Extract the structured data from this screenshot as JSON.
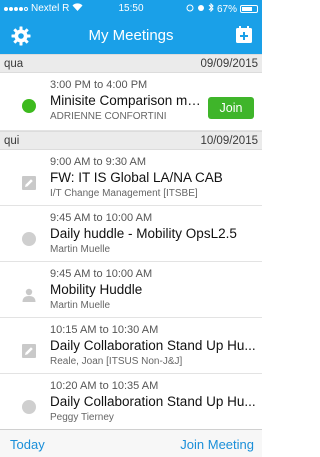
{
  "status_bar": {
    "carrier": "Nextel R",
    "time": "15:50",
    "battery": "67%"
  },
  "header": {
    "title": "My Meetings",
    "left_icon": "gear-icon",
    "right_icon": "calendar-add-icon"
  },
  "sections": [
    {
      "day": "qua",
      "date": "09/09/2015",
      "meetings": [
        {
          "time": "3:00 PM to 4:00 PM",
          "title": "Minisite Comparison me...",
          "organizer": "ADRIENNE CONFORTINI",
          "status_icon": "green-dot",
          "join_label": "Join"
        }
      ]
    },
    {
      "day": "qui",
      "date": "10/09/2015",
      "meetings": [
        {
          "time": "9:00 AM to 9:30 AM",
          "title": "FW: IT IS Global LA/NA CAB",
          "organizer": "I/T Change Management [ITSBE]",
          "status_icon": "edit-icon"
        },
        {
          "time": "9:45 AM to 10:00 AM",
          "title": "Daily huddle - Mobility OpsL2.5",
          "organizer": "Martin Muelle",
          "status_icon": "grey-dot"
        },
        {
          "time": "9:45 AM to 10:00 AM",
          "title": "Mobility Huddle",
          "organizer": "Martin Muelle",
          "status_icon": "person-icon"
        },
        {
          "time": "10:15 AM to 10:30 AM",
          "title": "Daily Collaboration Stand Up Hu...",
          "organizer": "Reale, Joan [ITSUS Non-J&J]",
          "status_icon": "edit-icon"
        },
        {
          "time": "10:20 AM to 10:35 AM",
          "title": "Daily Collaboration Stand Up Hu...",
          "organizer": "Peggy Tierney",
          "status_icon": "grey-dot"
        }
      ]
    }
  ],
  "toolbar": {
    "today_label": "Today",
    "join_meeting_label": "Join Meeting"
  },
  "colors": {
    "brand_blue": "#1aa0e8",
    "join_green": "#3fb52a",
    "link_blue": "#1a8fd9"
  }
}
